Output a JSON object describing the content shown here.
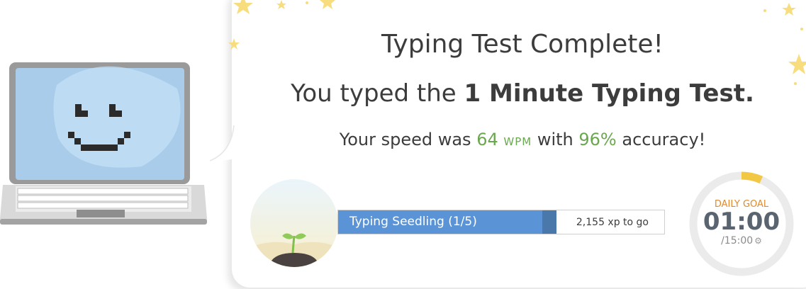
{
  "result": {
    "title": "Typing Test Complete!",
    "subtitle_prefix": "You typed the ",
    "subtitle_test": "1 Minute Typing Test.",
    "speed_prefix": "Your speed was ",
    "wpm_value": "64",
    "wpm_unit": "WPM",
    "speed_middle": " with ",
    "accuracy": "96%",
    "speed_suffix": " accuracy!"
  },
  "level": {
    "label": "Typing Seedling (1/5)",
    "progress_fraction": 0.67,
    "xp_to_go": "2,155 xp to go"
  },
  "daily_goal": {
    "title": "DAILY GOAL",
    "time": "01:00",
    "total": "/15:00",
    "progress_fraction": 0.067,
    "settings_icon": "gear-icon"
  },
  "colors": {
    "accent_green": "#6aa84f",
    "level_blue": "#5b94d6",
    "goal_orange": "#e08a2d",
    "goal_ring": "#f2c744",
    "star": "#f7dd7d"
  },
  "icons": [
    "laptop-smiley-illustration",
    "seedling-illustration",
    "star-icon",
    "gear-icon"
  ]
}
